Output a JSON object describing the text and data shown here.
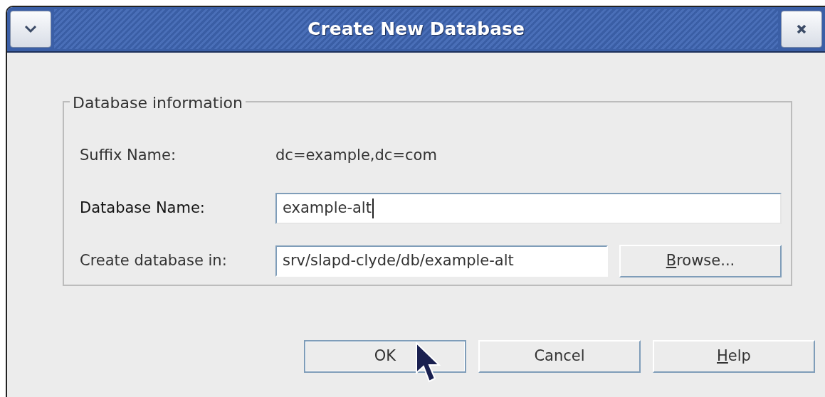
{
  "window": {
    "title": "Create New Database"
  },
  "group": {
    "title": "Database information",
    "suffix": {
      "label": "Suffix Name:",
      "value": "dc=example,dc=com"
    },
    "name_field": {
      "label": "Database Name:",
      "value": "example-alt",
      "focused": true
    },
    "location_field": {
      "label": "Create database in:",
      "value": "srv/slapd-clyde/db/example-alt"
    },
    "browse_button": {
      "mnemonic": "B",
      "rest": "rowse..."
    }
  },
  "buttons": [
    {
      "rest": "OK",
      "default": true
    },
    {
      "rest": "Cancel",
      "default": false
    },
    {
      "mnemonic": "H",
      "rest": "elp",
      "default": false
    }
  ]
}
